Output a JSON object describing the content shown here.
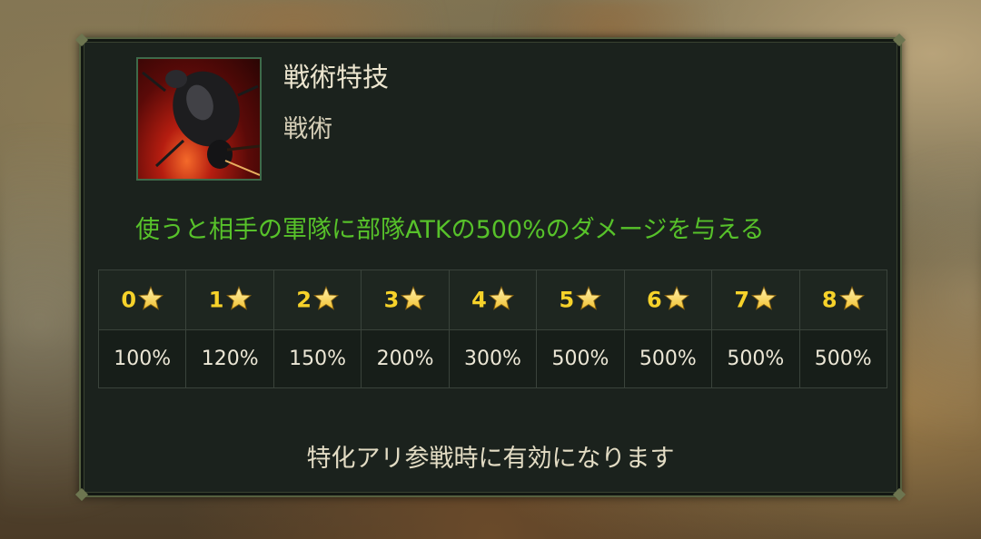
{
  "skill": {
    "name": "戦術特技",
    "category": "戦術",
    "description": "使うと相手の軍隊に部隊ATKの500%のダメージを与える"
  },
  "levels": [
    {
      "stars": "0",
      "value": "100%"
    },
    {
      "stars": "1",
      "value": "120%"
    },
    {
      "stars": "2",
      "value": "150%"
    },
    {
      "stars": "3",
      "value": "200%"
    },
    {
      "stars": "4",
      "value": "300%"
    },
    {
      "stars": "5",
      "value": "500%"
    },
    {
      "stars": "6",
      "value": "500%"
    },
    {
      "stars": "7",
      "value": "500%"
    },
    {
      "stars": "8",
      "value": "500%"
    }
  ],
  "footer": "特化アリ参戦時に有効になります",
  "colors": {
    "description": "#57c22a",
    "star": "#f2c230",
    "level_number": "#f6d22a"
  },
  "icons": {
    "skill": "ant-skill-icon",
    "level": "star-icon"
  }
}
